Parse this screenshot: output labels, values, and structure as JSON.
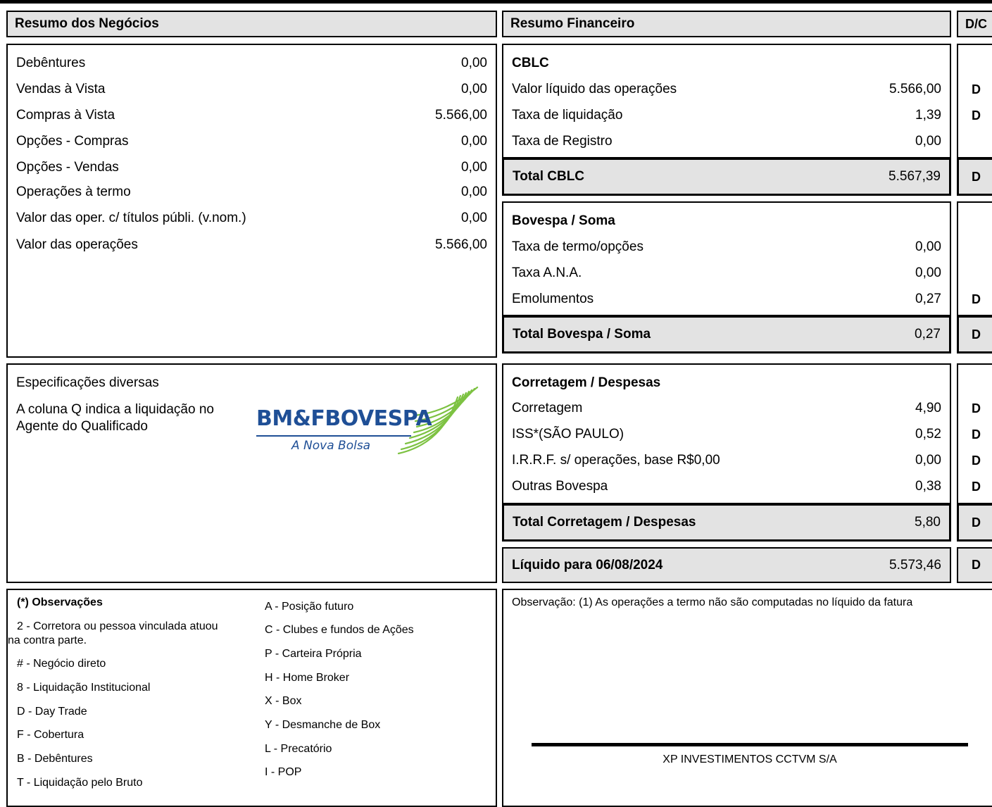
{
  "resumo_negocios": {
    "title": "Resumo dos Negócios",
    "rows": [
      {
        "label": "Debêntures",
        "value": "0,00"
      },
      {
        "label": "Vendas à Vista",
        "value": "0,00"
      },
      {
        "label": "Compras à Vista",
        "value": "5.566,00"
      },
      {
        "label": "Opções - Compras",
        "value": "0,00"
      },
      {
        "label": "Opções - Vendas",
        "value": "0,00"
      },
      {
        "label": "Operações à termo",
        "value": "0,00"
      },
      {
        "label": "Valor das oper. c/ títulos públi. (v.nom.)",
        "value": "0,00"
      },
      {
        "label": "Valor das operações",
        "value": "5.566,00"
      }
    ]
  },
  "resumo_financeiro": {
    "title": "Resumo Financeiro",
    "dc_header": "D/C",
    "cblc": {
      "title": "CBLC",
      "rows": [
        {
          "label": "Valor líquido das operações",
          "value": "5.566,00",
          "dc": "D"
        },
        {
          "label": "Taxa de liquidação",
          "value": "1,39",
          "dc": "D"
        },
        {
          "label": "Taxa de Registro",
          "value": "0,00",
          "dc": ""
        }
      ],
      "total": {
        "label": "Total CBLC",
        "value": "5.567,39",
        "dc": "D"
      }
    },
    "bovespa": {
      "title": "Bovespa / Soma",
      "rows": [
        {
          "label": "Taxa de termo/opções",
          "value": "0,00",
          "dc": ""
        },
        {
          "label": "Taxa A.N.A.",
          "value": "0,00",
          "dc": ""
        },
        {
          "label": "Emolumentos",
          "value": "0,27",
          "dc": "D"
        }
      ],
      "total": {
        "label": "Total Bovespa / Soma",
        "value": "0,27",
        "dc": "D"
      }
    },
    "corretagem": {
      "title": "Corretagem / Despesas",
      "rows": [
        {
          "label": "Corretagem",
          "value": "4,90",
          "dc": "D"
        },
        {
          "label": "ISS*(SÃO PAULO)",
          "value": "0,52",
          "dc": "D"
        },
        {
          "label": "I.R.R.F. s/ operações, base R$0,00",
          "value": "0,00",
          "dc": "D"
        },
        {
          "label": "Outras Bovespa",
          "value": "0,38",
          "dc": "D"
        }
      ],
      "total": {
        "label": "Total Corretagem / Despesas",
        "value": "5,80",
        "dc": "D"
      }
    },
    "liquido": {
      "label": "Líquido para 06/08/2024",
      "value": "5.573,46",
      "dc": "D"
    }
  },
  "especificacoes": {
    "title": "Especificações diversas",
    "line1": "A coluna Q indica a liquidação no",
    "line2": "Agente do Qualificado",
    "logo_main": "BM&FBOVESPA",
    "logo_sub": "A Nova Bolsa"
  },
  "observacoes": {
    "title": "(*) Observações",
    "left": [
      "2 - Corretora ou pessoa vinculada atuou",
      "na contra parte.",
      "# - Negócio direto",
      "8 - Liquidação Institucional",
      "D - Day Trade",
      "F - Cobertura",
      "B - Debêntures",
      "T - Liquidação pelo Bruto"
    ],
    "right": [
      "A - Posição futuro",
      "C - Clubes e fundos de Ações",
      "P - Carteira Própria",
      "H - Home Broker",
      "X - Box",
      "Y - Desmanche de Box",
      "L - Precatório",
      "I - POP"
    ]
  },
  "observacao_termo": "Observação: (1) As operações a termo não são computadas no líquido da fatura",
  "empresa": "XP INVESTIMENTOS CCTVM S/A",
  "colors": {
    "header_bg": "#e3e3e3",
    "logo_blue": "#1f4f96",
    "logo_green": "#7dc242"
  }
}
